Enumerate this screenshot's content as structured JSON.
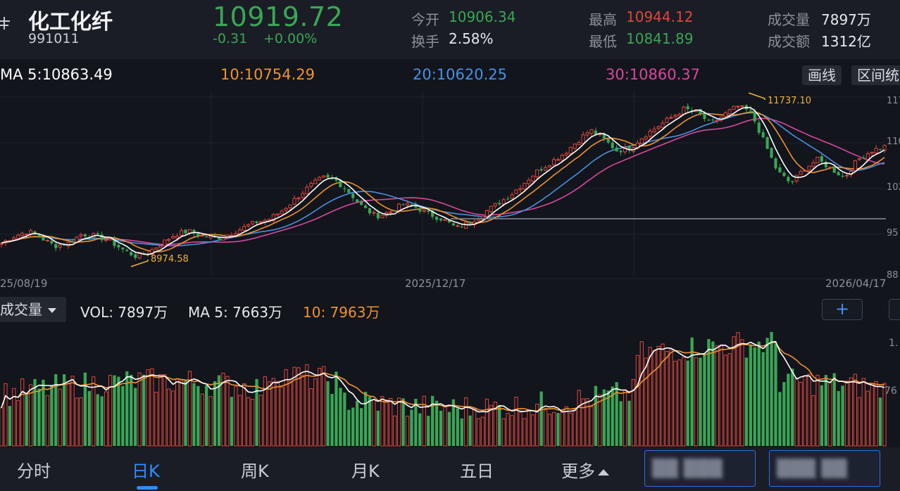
{
  "header": {
    "title": "化工化纤",
    "code": "991011",
    "price": "10919.72",
    "change": "-0.31",
    "change_pct": "+0.00%",
    "stats": [
      {
        "label": "今开",
        "value": "10906.34",
        "color": "#3aa655"
      },
      {
        "label": "换手",
        "value": "2.58%",
        "color": "#e6e8ec"
      },
      {
        "label": "最高",
        "value": "10944.12",
        "color": "#e0473c"
      },
      {
        "label": "最低",
        "value": "10841.89",
        "color": "#3aa655"
      },
      {
        "label": "成交量",
        "value": "7897万",
        "color": "#e6e8ec"
      },
      {
        "label": "成交额",
        "value": "1312亿",
        "color": "#e6e8ec"
      }
    ]
  },
  "ma": {
    "ma5": "MA 5:10863.49",
    "ma10": "10:10754.29",
    "ma20": "20:10620.25",
    "ma30": "30:10860.37",
    "draw_btn": "画线",
    "range_btn": "区间统"
  },
  "chart": {
    "dates": [
      "25/08/19",
      "2025/12/17",
      "2026/04/17"
    ],
    "y_ticks": [
      "117",
      "110",
      "102",
      "95",
      "88"
    ],
    "max_label": "11737.10",
    "min_label": "8974.58"
  },
  "volume": {
    "selector": "成交量",
    "vol": "VOL: 7897万",
    "ma5": "MA 5: 7663万",
    "ma10": "10: 7963万",
    "plus": "+",
    "y_ticks": [
      "1.",
      "76"
    ]
  },
  "nav": {
    "items": [
      "分时",
      "日K",
      "周K",
      "月K",
      "五日",
      "更多"
    ]
  },
  "colors": {
    "up": "#e0473c",
    "down": "#3aa655",
    "ma5": "#ffffff",
    "ma10": "#f0922f",
    "ma20": "#4a90e2",
    "ma30": "#d9479d",
    "accent": "#2f8cff"
  },
  "chart_data": {
    "type": "candlestick",
    "x_labels": [
      "25/08/19",
      "2025/12/17",
      "2026/04/17"
    ],
    "y_range": [
      8800,
      11800
    ],
    "ylim_ticks": [
      11700,
      11000,
      10200,
      9500,
      8800
    ],
    "series": [
      {
        "name": "MA 5",
        "last": 10863.49
      },
      {
        "name": "10",
        "last": 10754.29
      },
      {
        "name": "20",
        "last": 10620.25
      },
      {
        "name": "30",
        "last": 10860.37
      }
    ],
    "close_path": [
      9300,
      9420,
      9500,
      9380,
      9250,
      9300,
      9450,
      9420,
      9350,
      9200,
      9080,
      9150,
      9300,
      9450,
      9500,
      9420,
      9380,
      9450,
      9550,
      9650,
      9700,
      9850,
      10050,
      10250,
      10400,
      10350,
      10150,
      9900,
      9750,
      9820,
      9950,
      9900,
      9780,
      9700,
      9550,
      9650,
      9800,
      9950,
      10100,
      10300,
      10500,
      10650,
      10800,
      11000,
      11200,
      11050,
      10850,
      10900,
      11100,
      11250,
      11400,
      11550,
      11500,
      11300,
      11450,
      11600,
      11500,
      11000,
      10500,
      10300,
      10550,
      10700,
      10550,
      10400,
      10700,
      10850,
      10920
    ],
    "annotations": [
      {
        "text": "11737.10"
      },
      {
        "text": "8974.58"
      }
    ]
  }
}
